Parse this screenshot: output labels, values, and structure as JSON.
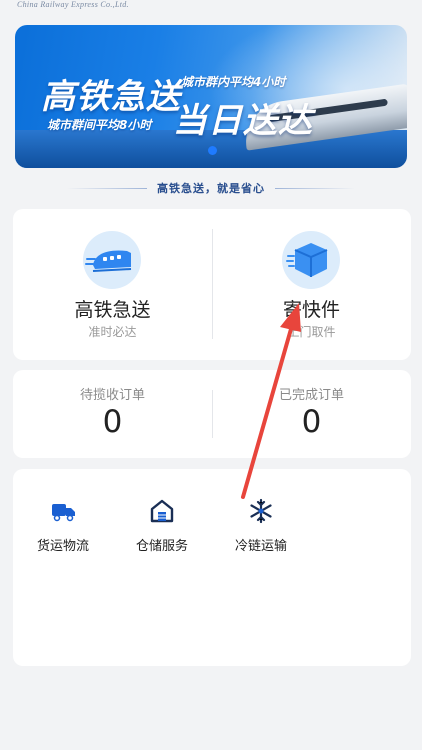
{
  "header": {
    "company_en": "China Railway Express Co.,Ltd."
  },
  "banner": {
    "headline_left": "高铁急送",
    "headline_right": "当日送达",
    "tagline_top": "城市群内平均4小时",
    "tagline_bottom": "城市群间平均8小时"
  },
  "slogan": "高铁急送，就是省心",
  "services": [
    {
      "title": "高铁急送",
      "subtitle": "准时必达",
      "icon": "train-icon"
    },
    {
      "title": "寄快件",
      "subtitle": "上门取件",
      "icon": "package-icon"
    }
  ],
  "orders": [
    {
      "label": "待揽收订单",
      "count": "0"
    },
    {
      "label": "已完成订单",
      "count": "0"
    }
  ],
  "features": [
    {
      "label": "货运物流",
      "icon": "truck-icon"
    },
    {
      "label": "仓储服务",
      "icon": "warehouse-icon"
    },
    {
      "label": "冷链运输",
      "icon": "snowflake-icon"
    }
  ],
  "colors": {
    "accent": "#1f7bff",
    "icon_bg": "#dcecfb",
    "annotation_arrow": "#e8453c"
  }
}
